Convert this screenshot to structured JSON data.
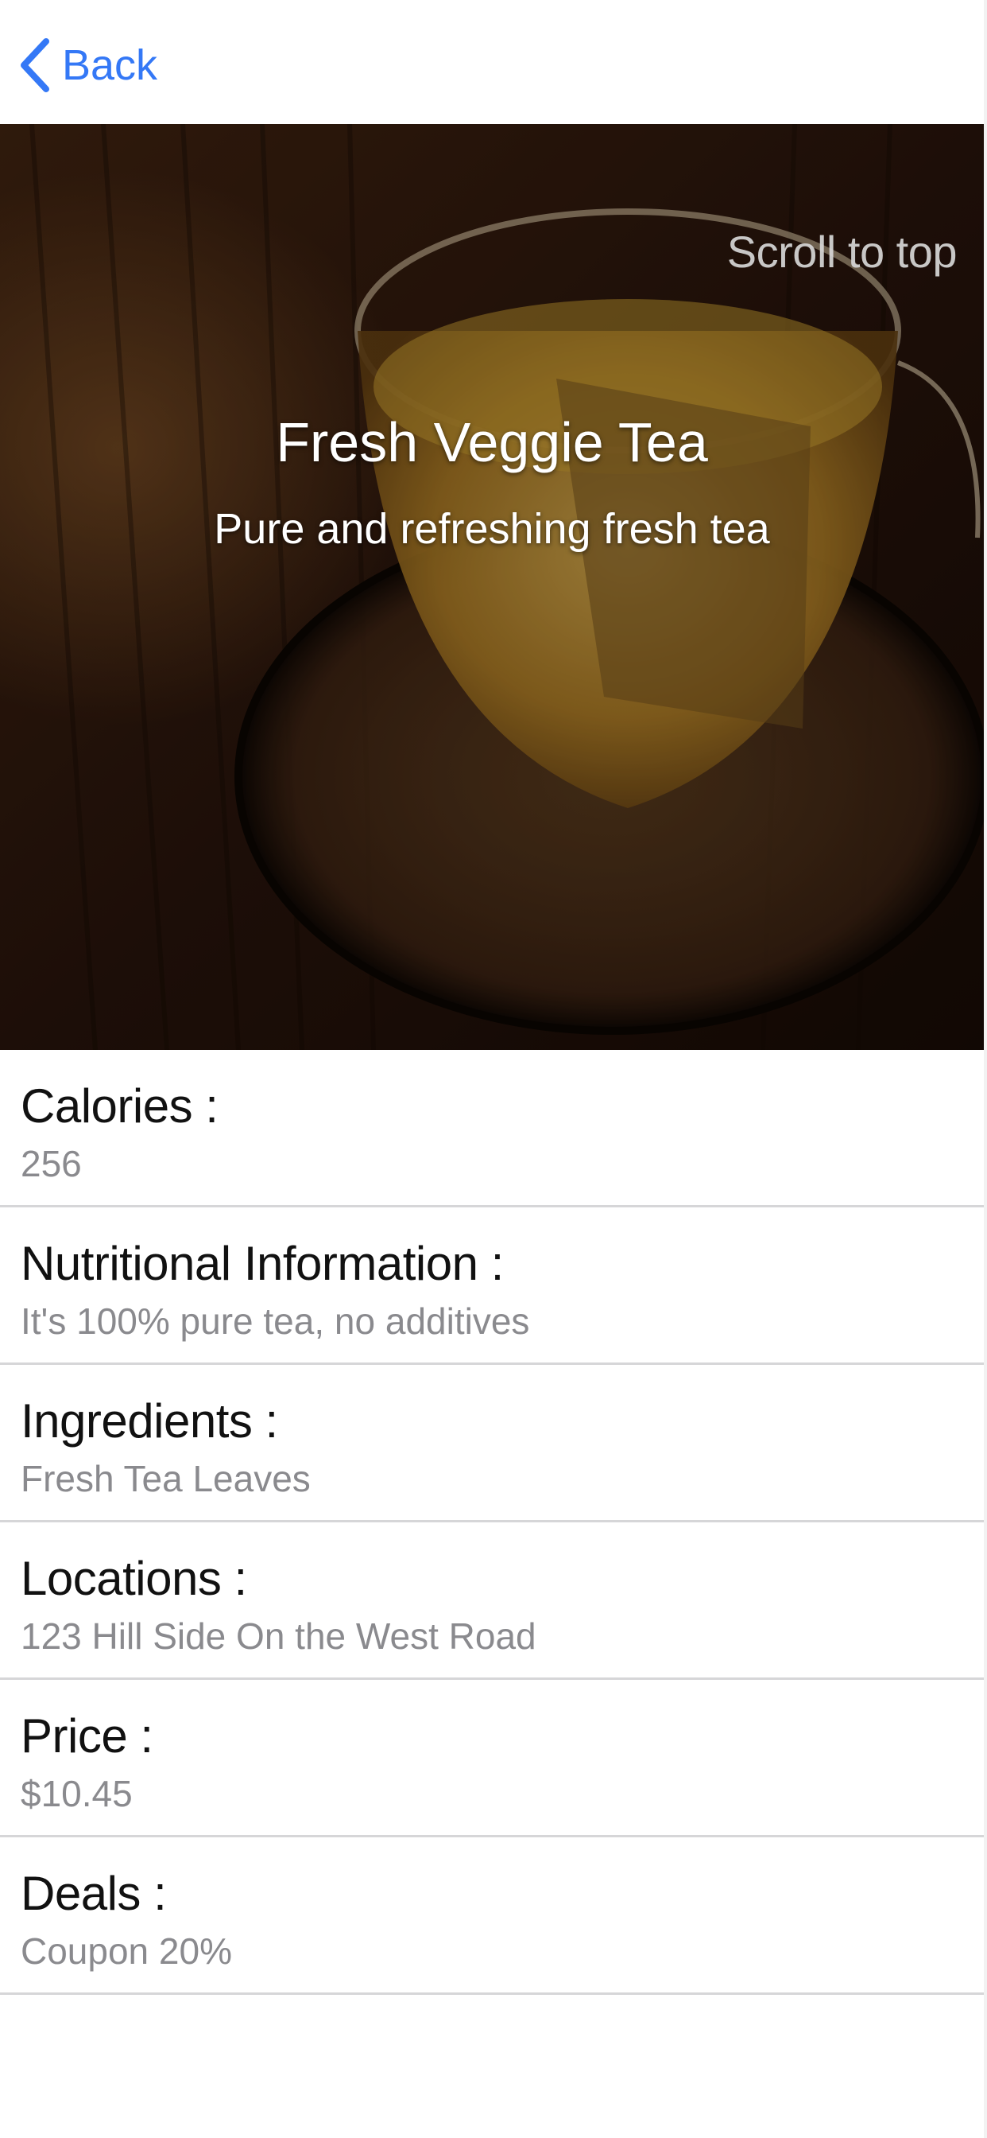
{
  "nav": {
    "back_label": "Back"
  },
  "hero": {
    "scroll_to_top": "Scroll to top",
    "title": "Fresh Veggie Tea",
    "subtitle": "Pure and refreshing fresh tea"
  },
  "details": [
    {
      "label": "Calories :",
      "value": "256"
    },
    {
      "label": "Nutritional Information :",
      "value": "It's 100% pure tea, no additives"
    },
    {
      "label": "Ingredients :",
      "value": "Fresh Tea Leaves"
    },
    {
      "label": "Locations :",
      "value": "123 Hill Side On the West Road"
    },
    {
      "label": "Price :",
      "value": "$10.45"
    },
    {
      "label": "Deals :",
      "value": "Coupon 20%"
    }
  ],
  "colors": {
    "accent": "#3478f6",
    "label": "#111111",
    "value": "#8a8a8e",
    "divider": "#d6d6d8"
  }
}
